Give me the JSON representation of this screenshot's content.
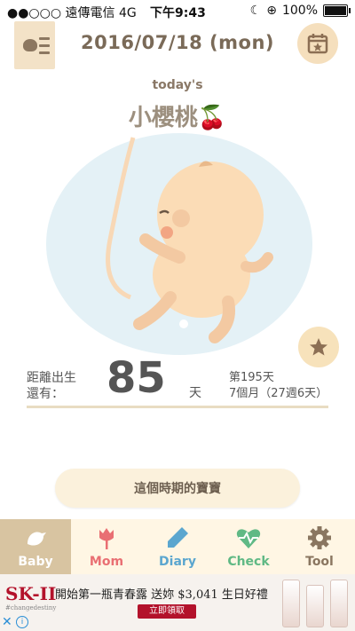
{
  "status": {
    "carrier": "●●○○○ 遠傳電信  4G",
    "time": "下午9:43",
    "battery": "100%"
  },
  "header": {
    "date": "2016/07/18 (mon)"
  },
  "today": {
    "label": "today's",
    "name": "小櫻桃🍒"
  },
  "info": {
    "left_line1": "距離出生",
    "left_line2": "還有：",
    "days": "85",
    "unit": "天",
    "right_line1": "第195天",
    "right_line2": "7個月（27週6天）"
  },
  "period_button": "這個時期的寶寶",
  "tabs": [
    {
      "label": "Baby",
      "icon": "bird-icon",
      "color": "#ffffff"
    },
    {
      "label": "Mom",
      "icon": "tulip-icon",
      "color": "#e96f73"
    },
    {
      "label": "Diary",
      "icon": "pen-icon",
      "color": "#5ba6cf"
    },
    {
      "label": "Check",
      "icon": "heartbeat-icon",
      "color": "#60b985"
    },
    {
      "label": "Tool",
      "icon": "gear-icon",
      "color": "#8a7660"
    }
  ],
  "ad": {
    "brand": "SK-II",
    "brand_tag": "#changedestiny",
    "text": "開始第一瓶青春露  送妳 $3,041 生日好禮",
    "cta": "立即領取"
  }
}
